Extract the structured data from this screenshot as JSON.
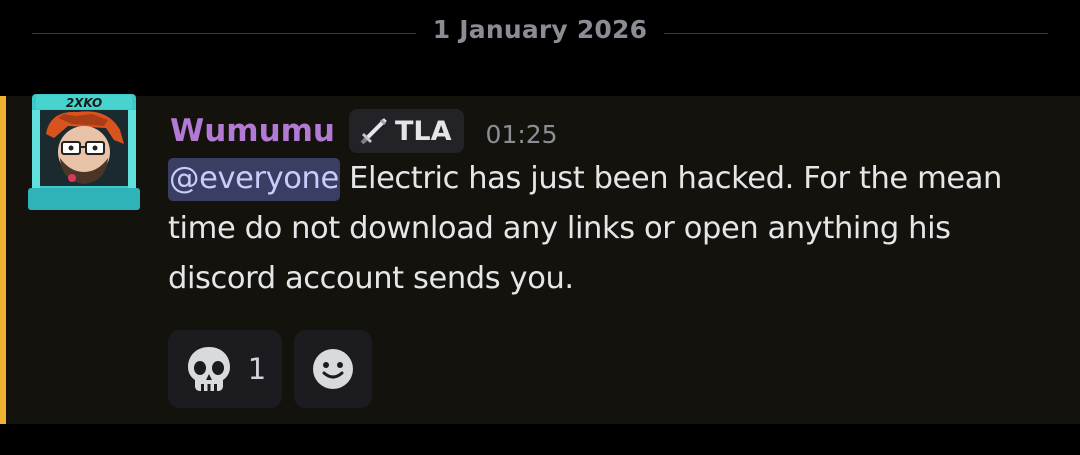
{
  "divider": {
    "date": "1 January 2026"
  },
  "message": {
    "author": "Wumumu",
    "author_color": "#b27ad4",
    "role": {
      "icon": "sword-icon",
      "label": "TLA"
    },
    "timestamp": "01:25",
    "mention": "@everyone",
    "body": " Electric has just been hacked. For the mean time do not download any links or open anything his discord account sends you.",
    "highlight_color": "#f0b232",
    "avatar_badge_text": "2XKO"
  },
  "reactions": [
    {
      "emoji": "skull-icon",
      "count": "1"
    },
    {
      "emoji": "add-reaction-icon"
    }
  ]
}
